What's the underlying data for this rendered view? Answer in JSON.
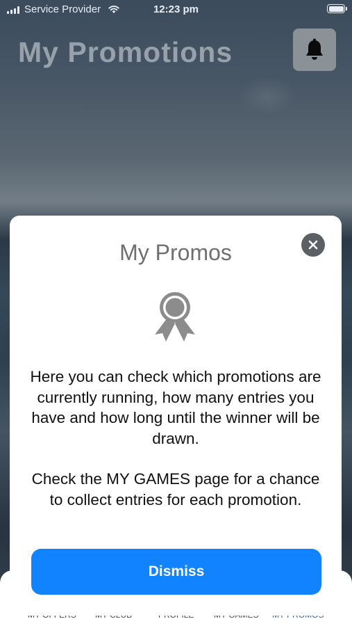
{
  "status_bar": {
    "carrier": "Service Provider",
    "time": "12:23 pm"
  },
  "header": {
    "title": "My Promotions",
    "bell_icon": "bell-icon"
  },
  "tab_bar": {
    "tabs": [
      {
        "label": "MY OFFERS",
        "active": false
      },
      {
        "label": "MY CLUB",
        "active": false
      },
      {
        "label": "PROFILE",
        "active": false
      },
      {
        "label": "MY GAMES",
        "active": false
      },
      {
        "label": "MY PROMOS",
        "active": true
      }
    ]
  },
  "modal": {
    "title": "My Promos",
    "icon": "award-ribbon-icon",
    "paragraph_1": "Here you can check which promotions are currently running, how many entries you have and how long until the winner will be drawn.",
    "paragraph_2": "Check the MY GAMES page for a chance to collect entries for each promotion.",
    "dismiss_label": "Dismiss",
    "close_icon": "close-icon"
  },
  "colors": {
    "accent": "#1183fe",
    "modal_background": "#ffffff",
    "close_button": "#5b6066",
    "icon_gray": "#8c8c8c"
  }
}
